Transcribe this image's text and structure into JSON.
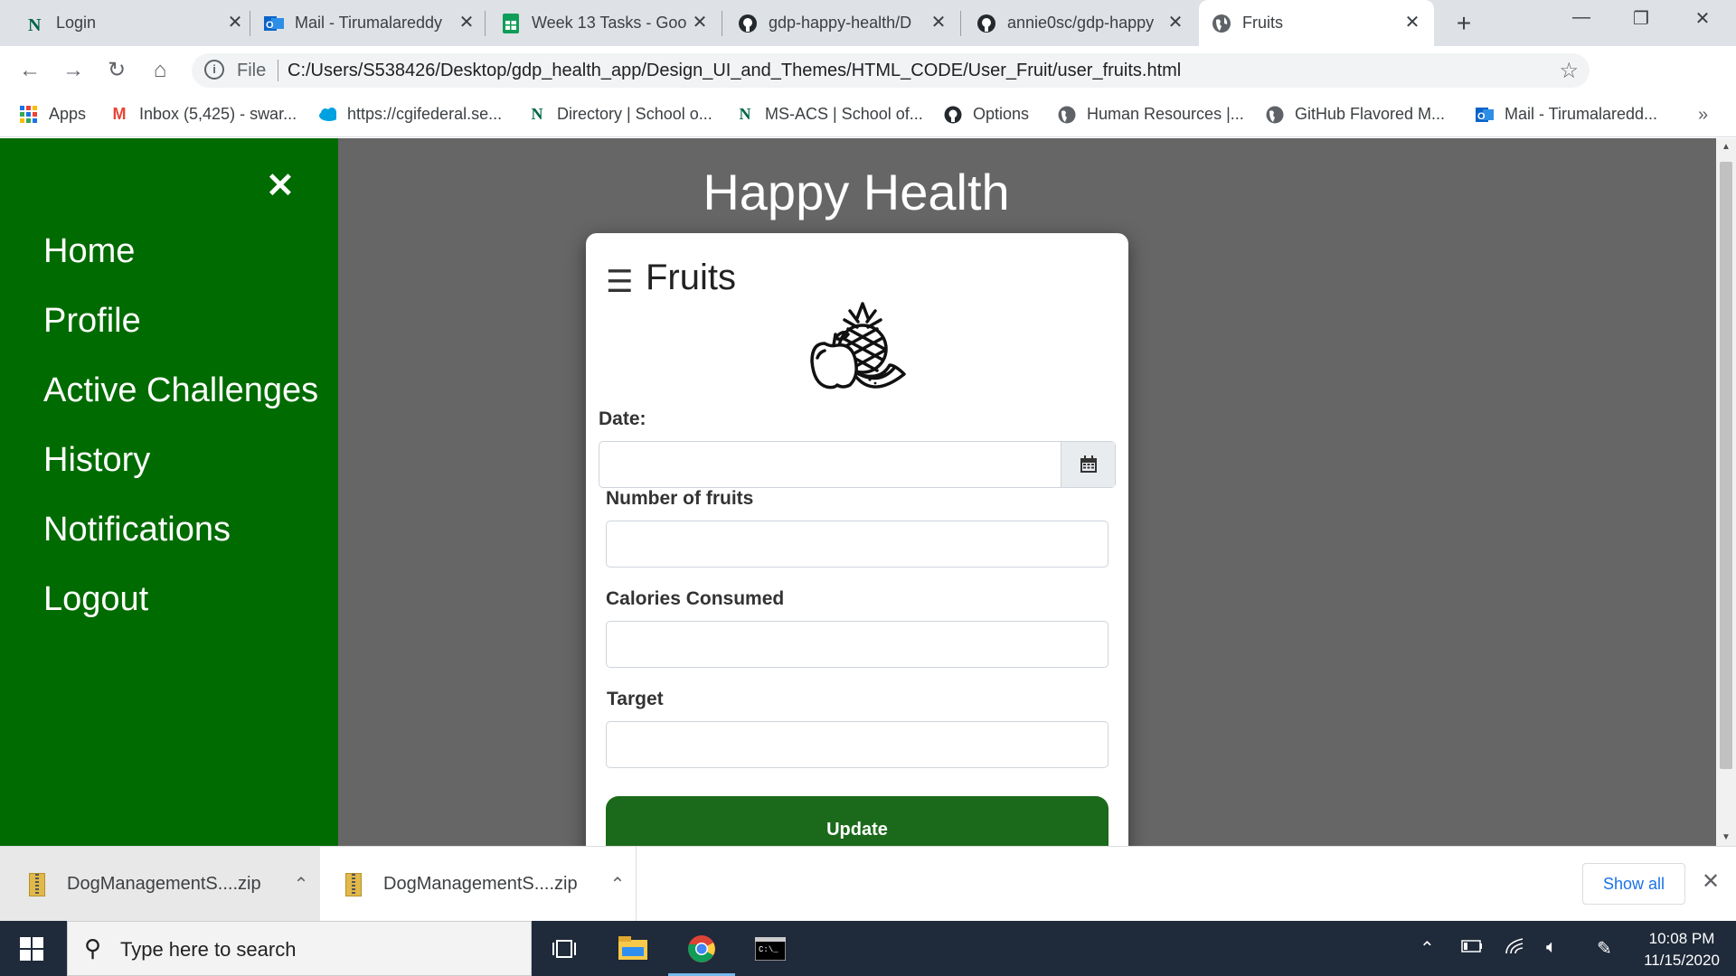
{
  "browser": {
    "tabs": [
      {
        "title": "Login",
        "favicon": "northwest-n-icon",
        "active": false
      },
      {
        "title": "Mail - Tirumalareddy",
        "favicon": "outlook-icon",
        "active": false
      },
      {
        "title": "Week 13 Tasks - Goo",
        "favicon": "google-sheets-icon",
        "active": false
      },
      {
        "title": "gdp-happy-health/D",
        "favicon": "github-icon",
        "active": false
      },
      {
        "title": "annie0sc/gdp-happy",
        "favicon": "github-icon",
        "active": false
      },
      {
        "title": "Fruits",
        "favicon": "globe-icon",
        "active": true
      }
    ],
    "address": {
      "scheme": "File",
      "url": "C:/Users/S538426/Desktop/gdp_health_app/Design_UI_and_Themes/HTML_CODE/User_Fruit/user_fruits.html"
    },
    "bookmarks": [
      {
        "label": "Apps",
        "icon": "apps-grid-icon"
      },
      {
        "label": "Inbox (5,425) - swar...",
        "icon": "gmail-icon"
      },
      {
        "label": "https://cgifederal.se...",
        "icon": "salesforce-cloud-icon"
      },
      {
        "label": "Directory | School o...",
        "icon": "northwest-n-icon"
      },
      {
        "label": "MS-ACS | School of...",
        "icon": "northwest-n-icon"
      },
      {
        "label": "Options",
        "icon": "github-icon"
      },
      {
        "label": "Human Resources |...",
        "icon": "globe-icon"
      },
      {
        "label": "GitHub Flavored M...",
        "icon": "globe-icon"
      },
      {
        "label": "Mail - Tirumalaredd...",
        "icon": "outlook-icon"
      }
    ]
  },
  "app": {
    "title": "Happy Health",
    "sidebar": {
      "items": [
        "Home",
        "Profile",
        "Active Challenges",
        "History",
        "Notifications",
        "Logout"
      ]
    },
    "card": {
      "title": "Fruits",
      "date_label": "Date:",
      "date_value": "",
      "fruits_label": "Number of fruits",
      "fruits_value": "",
      "calories_label": "Calories Consumed",
      "calories_value": "",
      "target_label": "Target",
      "target_value": "",
      "update_label": "Update"
    }
  },
  "downloads": {
    "items": [
      "DogManagementS....zip",
      "DogManagementS....zip"
    ],
    "show_all": "Show all"
  },
  "taskbar": {
    "search_placeholder": "Type here to search",
    "time": "10:08 PM",
    "date": "11/15/2020"
  },
  "colors": {
    "sidebar": "#006b00",
    "update_button": "#1b6a1b",
    "backdrop": "#666666"
  }
}
